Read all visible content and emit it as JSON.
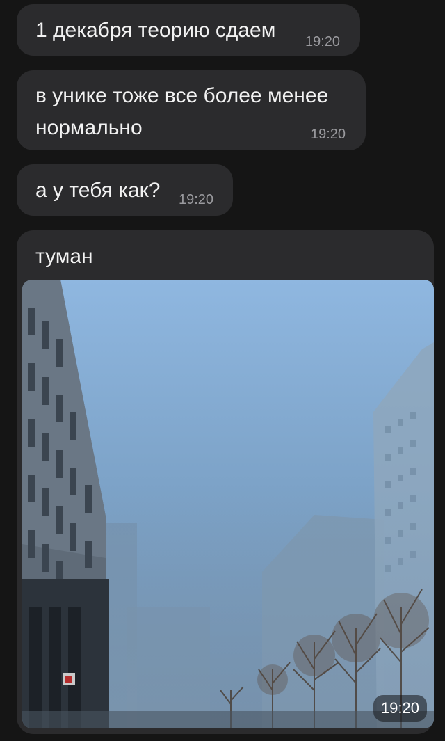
{
  "messages": [
    {
      "text": "1 декабря теорию сдаем",
      "time": "19:20"
    },
    {
      "text": "в унике тоже все более менее нормально",
      "time": "19:20"
    },
    {
      "text": "а у тебя как?",
      "time": "19:20"
    },
    {
      "text": "туман",
      "time": "19:20",
      "attachment": "photo"
    }
  ]
}
